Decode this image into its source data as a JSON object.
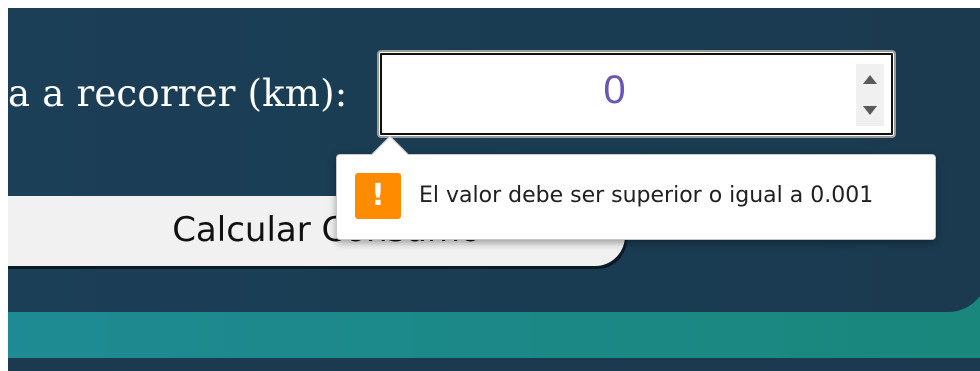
{
  "form": {
    "distance_label": "a a recorrer (km):",
    "distance_value": "0",
    "calculate_button": "Calcular Consumo"
  },
  "validation": {
    "message": "El valor debe ser superior o igual a 0.001",
    "icon": "warning-icon",
    "icon_glyph": "!"
  },
  "colors": {
    "panel": "#1b3f57",
    "band_start": "#1e8a93",
    "band_end": "#1a877c",
    "input_value": "#6a56b4",
    "warning": "#ff8c00"
  }
}
